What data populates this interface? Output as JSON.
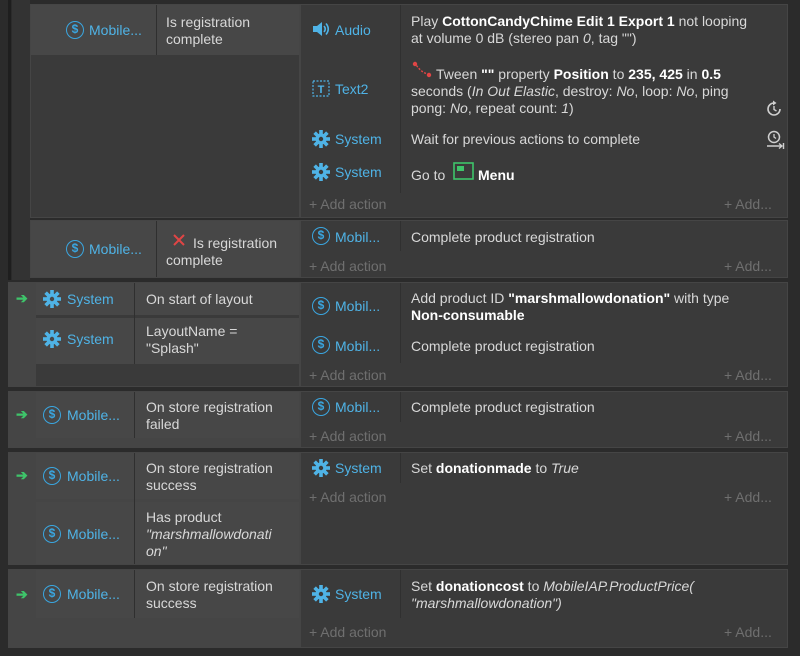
{
  "labels": {
    "add_action": "Add action",
    "add_more": "Add..."
  },
  "rows": {
    "r1": {
      "cond1": {
        "object": "Mobile...",
        "text": [
          "Is registration",
          "complete"
        ]
      },
      "act_audio": {
        "object": "Audio",
        "line1_pre": "Play ",
        "line1_bold": "CottonCandyChime Edit 1 Export 1",
        "line1_post": " not looping",
        "line2": "at volume 0 dB (stereo pan ",
        "line2_i": "0",
        "line2_post": ", tag \"\")"
      },
      "act_text2": {
        "object": "Text2",
        "l1_pre": "Tween ",
        "l1_b1": "\"\"",
        "l1_mid": " property ",
        "l1_b2": "Position",
        "l1_mid2": " to ",
        "l1_b3": "235, 425",
        "l1_mid3": " in ",
        "l1_b4": "0.5",
        "l2_pre": "seconds (",
        "l2_i1": "In Out Elastic",
        "l2_mid": ", destroy: ",
        "l2_i2": "No",
        "l2_mid2": ", loop: ",
        "l2_i3": "No",
        "l2_post": ", ping",
        "l3_pre": "pong: ",
        "l3_i1": "No",
        "l3_mid": ", repeat count: ",
        "l3_i2": "1",
        "l3_post": ")"
      },
      "act_wait": {
        "object": "System",
        "text": "Wait for previous actions to complete"
      },
      "act_goto": {
        "object": "System",
        "pre": "Go to ",
        "layout": "Menu"
      }
    },
    "r2": {
      "cond1": {
        "object": "Mobile...",
        "text": [
          "Is registration",
          "complete"
        ]
      },
      "act1": {
        "object": "Mobil...",
        "text": "Complete product registration"
      }
    },
    "r3": {
      "cond1": {
        "object": "System",
        "text": "On start of layout"
      },
      "cond2": {
        "object": "System",
        "text": [
          "LayoutName =",
          "\"Splash\""
        ]
      },
      "act1": {
        "object": "Mobil...",
        "pre": "Add product ID ",
        "bold": "\"marshmallowdonation\"",
        "post": " with type",
        "bold2": "Non-consumable"
      },
      "act2": {
        "object": "Mobil...",
        "text": "Complete product registration"
      }
    },
    "r4": {
      "cond1": {
        "object": "Mobile...",
        "text": [
          "On store registration",
          "failed"
        ]
      },
      "act1": {
        "object": "Mobil...",
        "text": "Complete product registration"
      }
    },
    "r5": {
      "cond1": {
        "object": "Mobile...",
        "text": [
          "On store registration",
          "success"
        ]
      },
      "cond2": {
        "object": "Mobile...",
        "text": [
          "Has product",
          "\"marshmallowdonati",
          "on\""
        ]
      },
      "act1": {
        "object": "System",
        "pre": "Set ",
        "bold": "donationmade",
        "mid": " to ",
        "ital": "True"
      }
    },
    "r6": {
      "cond1": {
        "object": "Mobile...",
        "text": [
          "On store registration",
          "success"
        ]
      },
      "act1": {
        "object": "System",
        "pre": "Set ",
        "bold": "donationcost",
        "mid": " to ",
        "ital1": "MobileIAP.ProductPrice(",
        "ital2": "\"marshmallowdonation\")"
      }
    }
  },
  "colors": {
    "accent": "#4fb3e6",
    "trigger_arrow": "#3ec46a",
    "invert_x": "#e04545",
    "layout_icon": "#3ec46a"
  }
}
